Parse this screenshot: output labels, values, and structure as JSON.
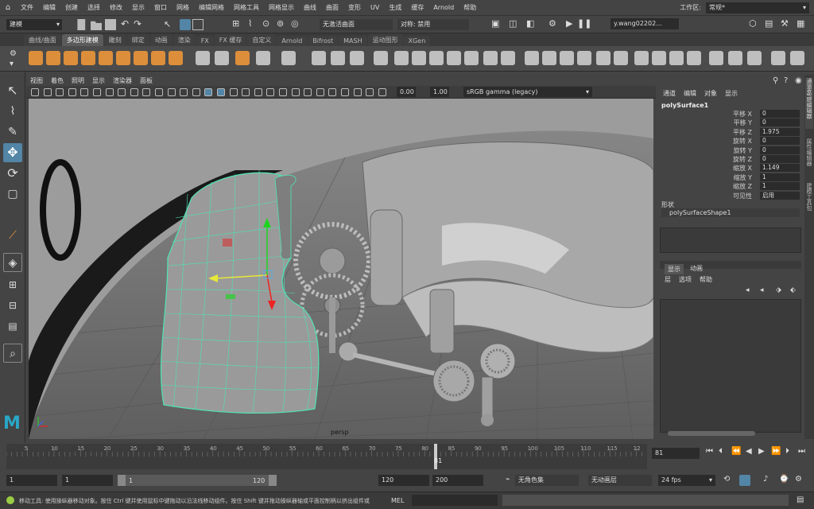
{
  "menubar": {
    "items": [
      "文件",
      "编辑",
      "创建",
      "选择",
      "修改",
      "显示",
      "窗口",
      "网格",
      "编辑网格",
      "网格工具",
      "网格显示",
      "曲线",
      "曲面",
      "变形",
      "UV",
      "生成",
      "缓存",
      "Arnold",
      "帮助"
    ],
    "workspace_label": "工作区:",
    "workspace_value": "常规*"
  },
  "statusline": {
    "mode_value": "建模",
    "live_surface": "无激活曲面",
    "symmetry": "对称: 禁用",
    "user": "y.wang02202..."
  },
  "shelf": {
    "tabs": [
      "曲线/曲面",
      "多边形建模",
      "雕刻",
      "绑定",
      "动画",
      "渲染",
      "FX",
      "FX 缓存",
      "自定义",
      "Arnold",
      "Bifrost",
      "MASH",
      "运动图形",
      "XGen"
    ],
    "active_tab": "多边形建模"
  },
  "panel": {
    "menus": [
      "视图",
      "着色",
      "照明",
      "显示",
      "渲染器",
      "面板"
    ],
    "exposure": "0.00",
    "gamma": "1.00",
    "colorspace": "sRGB gamma (legacy)",
    "camera_label": "persp"
  },
  "channelbox": {
    "menus": [
      "通道",
      "编辑",
      "对象",
      "显示"
    ],
    "object_name": "polySurface1",
    "channels": [
      {
        "label": "平移 X",
        "value": "0"
      },
      {
        "label": "平移 Y",
        "value": "0"
      },
      {
        "label": "平移 Z",
        "value": "1.975"
      },
      {
        "label": "旋转 X",
        "value": "0"
      },
      {
        "label": "旋转 Y",
        "value": "0"
      },
      {
        "label": "旋转 Z",
        "value": "0"
      },
      {
        "label": "缩放 X",
        "value": "1.149"
      },
      {
        "label": "缩放 Y",
        "value": "1"
      },
      {
        "label": "缩放 Z",
        "value": "1"
      },
      {
        "label": "可见性",
        "value": "启用"
      }
    ],
    "shapes_label": "形状",
    "shape_name": "polySurfaceShape1"
  },
  "layers": {
    "tabs": [
      "显示",
      "动画"
    ],
    "menus": [
      "层",
      "选项",
      "帮助"
    ]
  },
  "side_tabs": [
    "通道盒/层编辑器",
    "属性编辑器",
    "建模工具包"
  ],
  "timeline": {
    "ticks": [
      "5",
      "10",
      "15",
      "20",
      "25",
      "30",
      "35",
      "40",
      "45",
      "50",
      "55",
      "60",
      "65",
      "70",
      "75",
      "80",
      "85",
      "90",
      "95",
      "100",
      "105",
      "110",
      "115",
      "12"
    ],
    "current_frame_marker": "81",
    "current_frame_field": "81"
  },
  "range": {
    "start_field": "1",
    "start_playback": "1",
    "slider_start": "1",
    "slider_end": "120",
    "end_playback": "120",
    "end_field": "200",
    "character_set": "无角色集",
    "anim_layer": "无动画层",
    "fps": "24 fps"
  },
  "helpline": {
    "text": "移动工具: 使用操纵器移动对象。按住 Ctrl 键并使用鼠标中键拖动以沿法线移动组件。按住 Shift 键并拖动操纵器轴或平面控制柄以挤出组件或",
    "mel_label": "MEL"
  },
  "colors": {
    "accent": "#5285a6",
    "wireframe": "#4fe3b5",
    "shelf_icon": "#e8943a"
  }
}
